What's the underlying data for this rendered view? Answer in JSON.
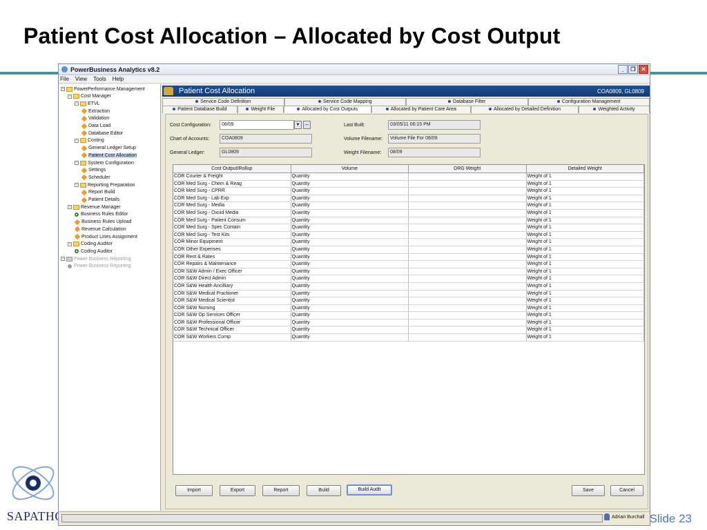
{
  "slide": {
    "title": "Patient Cost Allocation – Allocated by Cost Output",
    "logo_text": "SAPATHO",
    "slide_number": "Slide 23"
  },
  "app": {
    "title": "PowerBusiness Analytics v8.2",
    "menu": [
      "File",
      "View",
      "Tools",
      "Help"
    ],
    "window_buttons": [
      "minimize",
      "restore",
      "close"
    ]
  },
  "tree": [
    {
      "label": "PowerPerformance Management",
      "type": "folder",
      "expanded": true
    },
    {
      "label": "Cost Manager",
      "type": "folder",
      "expanded": true
    },
    {
      "label": "ETVL",
      "type": "folder",
      "expanded": true
    },
    {
      "label": "Extraction",
      "type": "leaf"
    },
    {
      "label": "Validation",
      "type": "leaf"
    },
    {
      "label": "Data Load",
      "type": "leaf"
    },
    {
      "label": "Database Editor",
      "type": "leaf"
    },
    {
      "label": "Costing",
      "type": "folder",
      "expanded": true
    },
    {
      "label": "General Ledger Setup",
      "type": "leaf"
    },
    {
      "label": "Patient Cost Allocation",
      "type": "leaf",
      "selected": true
    },
    {
      "label": "System Configuration",
      "type": "folder",
      "expanded": true
    },
    {
      "label": "Settings",
      "type": "leaf"
    },
    {
      "label": "Scheduler",
      "type": "leaf"
    },
    {
      "label": "Reporting Preparation",
      "type": "folder",
      "expanded": true
    },
    {
      "label": "Report Build",
      "type": "leaf"
    },
    {
      "label": "Patient Details",
      "type": "leaf"
    },
    {
      "label": "Revenue Manager",
      "type": "folder",
      "expanded": true
    },
    {
      "label": "Business Rules Editor",
      "type": "circle"
    },
    {
      "label": "Business Rules Upload",
      "type": "leaf"
    },
    {
      "label": "Revenue Calculation",
      "type": "leaf"
    },
    {
      "label": "Product Lines Assignment",
      "type": "leaf"
    },
    {
      "label": "Coding Auditor",
      "type": "folder",
      "expanded": true
    },
    {
      "label": "Coding Auditor",
      "type": "circle"
    },
    {
      "label": "Power Business Reporting",
      "type": "folder-grey",
      "expanded": true
    },
    {
      "label": "Power Business Reporting",
      "type": "circle-grey"
    }
  ],
  "panel": {
    "title": "Patient Cost Allocation",
    "context": "COA0809, GL0809",
    "tabs_row1": [
      "Service Code Definition",
      "Service Code Mapping",
      "Database Filter",
      "Configuration Management"
    ],
    "tabs_row2": [
      "Patient Database Build",
      "Weight File",
      "Allocated by Cost Outputs",
      "Allocated by Patient Care Area",
      "Allocated by Detailed Definition",
      "Weighted Activity"
    ],
    "active_tab": "Allocated by Cost Outputs"
  },
  "form": {
    "cost_configuration_label": "Cost Configuration:",
    "cost_configuration_value": "08/09",
    "chart_of_accounts_label": "Chart of Accounts:",
    "chart_of_accounts_value": "COA0809",
    "general_ledger_label": "General Ledger:",
    "general_ledger_value": "GL0809",
    "last_built_label": "Last Built:",
    "last_built_value": "03/05/11 06:15 PM",
    "volume_filename_label": "Volume Filename:",
    "volume_filename_value": "Volume File For 08/09",
    "weight_filename_label": "Weight Filename:",
    "weight_filename_value": "08/09"
  },
  "table": {
    "columns": [
      "Cost Output/Rollup",
      "Volume",
      "DRG Weight",
      "Detailed Weight"
    ],
    "rows": [
      [
        "COR Courier & Freight",
        "Quantity",
        "",
        "Weight of 1"
      ],
      [
        "COR Med Surg - Chem & Reag",
        "Quantity",
        "",
        "Weight of 1"
      ],
      [
        "COR Med Surg - CPRR",
        "Quantity",
        "",
        "Weight of 1"
      ],
      [
        "COR Med Surg - Lab Exp",
        "Quantity",
        "",
        "Weight of 1"
      ],
      [
        "COR Med Surg - Media",
        "Quantity",
        "",
        "Weight of 1"
      ],
      [
        "COR Med Surg - Oxoid Media",
        "Quantity",
        "",
        "Weight of 1"
      ],
      [
        "COR Med Surg - Patient Consum",
        "Quantity",
        "",
        "Weight of 1"
      ],
      [
        "COR Med Surg - Spec Contain",
        "Quantity",
        "",
        "Weight of 1"
      ],
      [
        "COR Med Surg - Test Kits",
        "Quantity",
        "",
        "Weight of 1"
      ],
      [
        "COR Minor Equipment",
        "Quantity",
        "",
        "Weight of 1"
      ],
      [
        "COR Other Expenses",
        "Quantity",
        "",
        "Weight of 1"
      ],
      [
        "COR Rent & Rates",
        "Quantity",
        "",
        "Weight of 1"
      ],
      [
        "COR Repairs & Maintenance",
        "Quantity",
        "",
        "Weight of 1"
      ],
      [
        "COR S&W Admin / Exec Officer",
        "Quantity",
        "",
        "Weight of 1"
      ],
      [
        "COR S&W Direct Admin",
        "Quantity",
        "",
        "Weight of 1"
      ],
      [
        "COR S&W Health Ancilliary",
        "Quantity",
        "",
        "Weight of 1"
      ],
      [
        "COR S&W Medical Practioner",
        "Quantity",
        "",
        "Weight of 1"
      ],
      [
        "COR S&W Medical Scientist",
        "Quantity",
        "",
        "Weight of 1"
      ],
      [
        "COR S&W Nursing",
        "Quantity",
        "",
        "Weight of 1"
      ],
      [
        "COR S&W Op Services Officer",
        "Quantity",
        "",
        "Weight of 1"
      ],
      [
        "COR S&W Professional Officer",
        "Quantity",
        "",
        "Weight of 1"
      ],
      [
        "COR S&W Technical Officer",
        "Quantity",
        "",
        "Weight of 1"
      ],
      [
        "COR S&W Workers Comp",
        "Quantity",
        "",
        "Weight of 1"
      ]
    ]
  },
  "buttons": {
    "import": "Import",
    "export": "Export",
    "report": "Report",
    "build": "Build",
    "build_audit": "Build Audit",
    "save": "Save",
    "cancel": "Cancel"
  },
  "status": {
    "user": "Adrian Burchall"
  }
}
